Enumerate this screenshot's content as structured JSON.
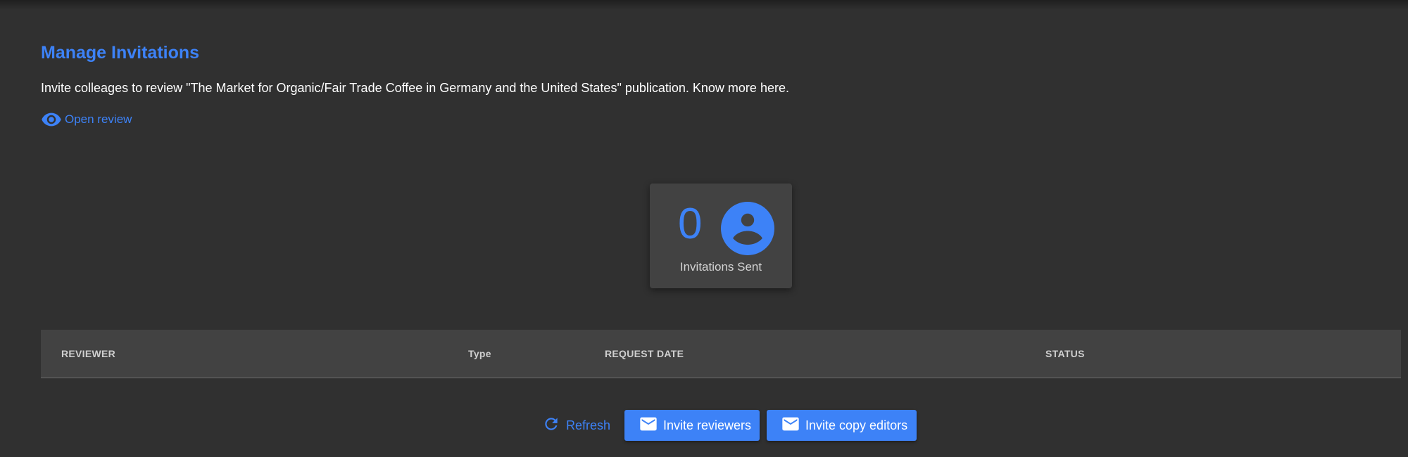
{
  "header": {
    "title": "Manage Invitations",
    "description": "Invite colleages to review \"The Market for Organic/Fair Trade Coffee in Germany and the United States\" publication. Know more here.",
    "open_review_label": "Open review"
  },
  "stats": {
    "count": "0",
    "label": "Invitations Sent"
  },
  "table": {
    "columns": [
      "REVIEWER",
      "Type",
      "REQUEST DATE",
      "STATUS"
    ],
    "rows": []
  },
  "actions": {
    "refresh_label": "Refresh",
    "invite_reviewers_label": "Invite reviewers",
    "invite_copy_editors_label": "Invite copy editors"
  },
  "icons": {
    "open_review": "eye-icon",
    "avatar": "account-circle-icon",
    "refresh": "refresh-icon",
    "mail": "mail-icon"
  },
  "colors": {
    "background": "#303030",
    "card": "#424242",
    "accent": "#3d82f7",
    "text": "#ffffff"
  }
}
